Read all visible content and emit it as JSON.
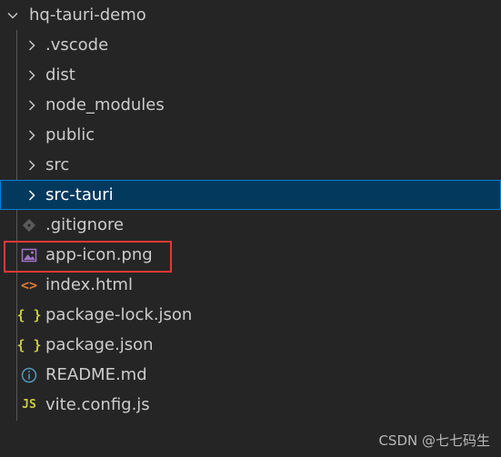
{
  "explorer": {
    "root": {
      "label": "hq-tauri-demo",
      "icon": "chevron-down-icon"
    },
    "folders": [
      {
        "label": ".vscode",
        "icon": "chevron-right-icon"
      },
      {
        "label": "dist",
        "icon": "chevron-right-icon"
      },
      {
        "label": "node_modules",
        "icon": "chevron-right-icon"
      },
      {
        "label": "public",
        "icon": "chevron-right-icon"
      },
      {
        "label": "src",
        "icon": "chevron-right-icon"
      },
      {
        "label": "src-tauri",
        "icon": "chevron-right-icon",
        "selected": true
      }
    ],
    "files": [
      {
        "label": ".gitignore",
        "icon": "git-file-icon",
        "icon_color": "#6d6d6d"
      },
      {
        "label": "app-icon.png",
        "icon": "image-file-icon",
        "icon_color": "#a074c4",
        "highlighted": true
      },
      {
        "label": "index.html",
        "icon": "html-file-icon",
        "icon_color": "#e37933",
        "glyph": "<>"
      },
      {
        "label": "package-lock.json",
        "icon": "json-file-icon",
        "icon_color": "#cbcb41",
        "glyph": "{ }"
      },
      {
        "label": "package.json",
        "icon": "json-file-icon",
        "icon_color": "#cbcb41",
        "glyph": "{ }"
      },
      {
        "label": "README.md",
        "icon": "info-file-icon",
        "icon_color": "#519aba",
        "glyph": "i"
      },
      {
        "label": "vite.config.js",
        "icon": "js-file-icon",
        "icon_color": "#cbcb41",
        "glyph": "JS"
      }
    ]
  },
  "colors": {
    "background": "#252526",
    "selected_background": "#04395e",
    "selected_border": "#007fd4",
    "highlight_border": "#e53935",
    "text": "#cccccc"
  },
  "watermark": "CSDN @七七码生"
}
